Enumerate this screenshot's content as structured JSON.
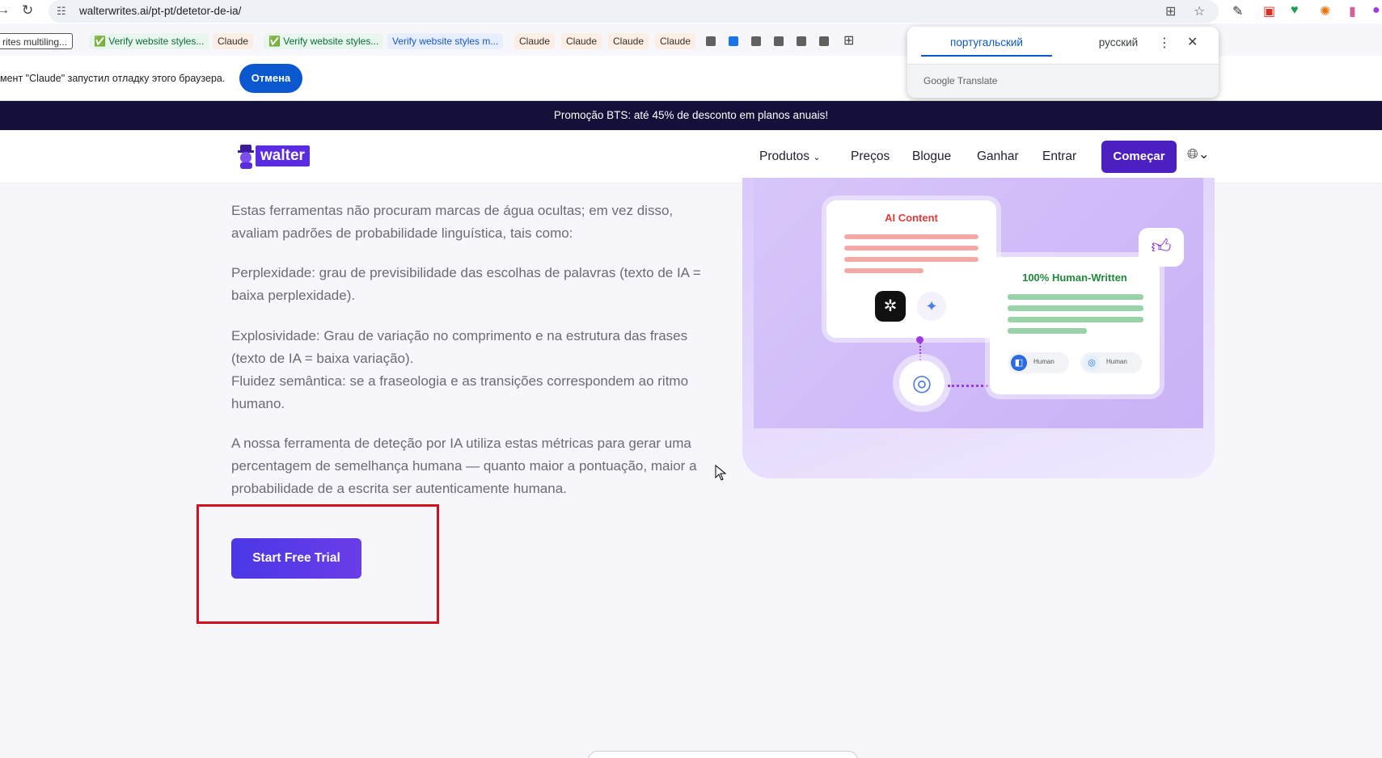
{
  "browser": {
    "url": "walterwrites.ai/pt-pt/detetor-de-ia/",
    "bookmarks": [
      "rites multiling...",
      "Verify website styles...",
      "Claude",
      "Verify website styles...",
      "Verify website styles m...",
      "Claude",
      "Claude",
      "Claude",
      "Claude"
    ],
    "debug_message": "мент \"Claude\" запустил отладку этого браузера.",
    "debug_cancel": "Отмена"
  },
  "translate_popup": {
    "source_lang": "португальский",
    "target_lang": "русский",
    "brand": "Google Translate"
  },
  "site": {
    "promo": "Promoção BTS: até 45% de desconto em planos anuais!",
    "logo_text": "walter",
    "nav": {
      "products": "Produtos",
      "pricing": "Preços",
      "blog": "Blogue",
      "earn": "Ganhar",
      "login": "Entrar",
      "cta": "Começar"
    }
  },
  "article": {
    "p1": "Estas ferramentas não procuram marcas de água ocultas; em vez disso, avaliam padrões de probabilidade linguística, tais como:",
    "p2": "Perplexidade: grau de previsibilidade das escolhas de palavras (texto de IA = baixa perplexidade).",
    "p3a": "Explosividade: Grau de variação no comprimento e na estrutura das frases (texto de IA = baixa variação).",
    "p3b": "Fluidez semântica: se a fraseologia e as transições correspondem ao ritmo humano.",
    "p4": "A nossa ferramenta de deteção por IA utiliza estas métricas para gerar uma percentagem de semelhança humana — quanto maior a pontuação, maior a probabilidade de a escrita ser autenticamente humana.",
    "cta": "Start Free Trial"
  },
  "illustration": {
    "ai_title": "AI Content",
    "human_title": "100% Human-Written",
    "chip_label": "Human"
  }
}
